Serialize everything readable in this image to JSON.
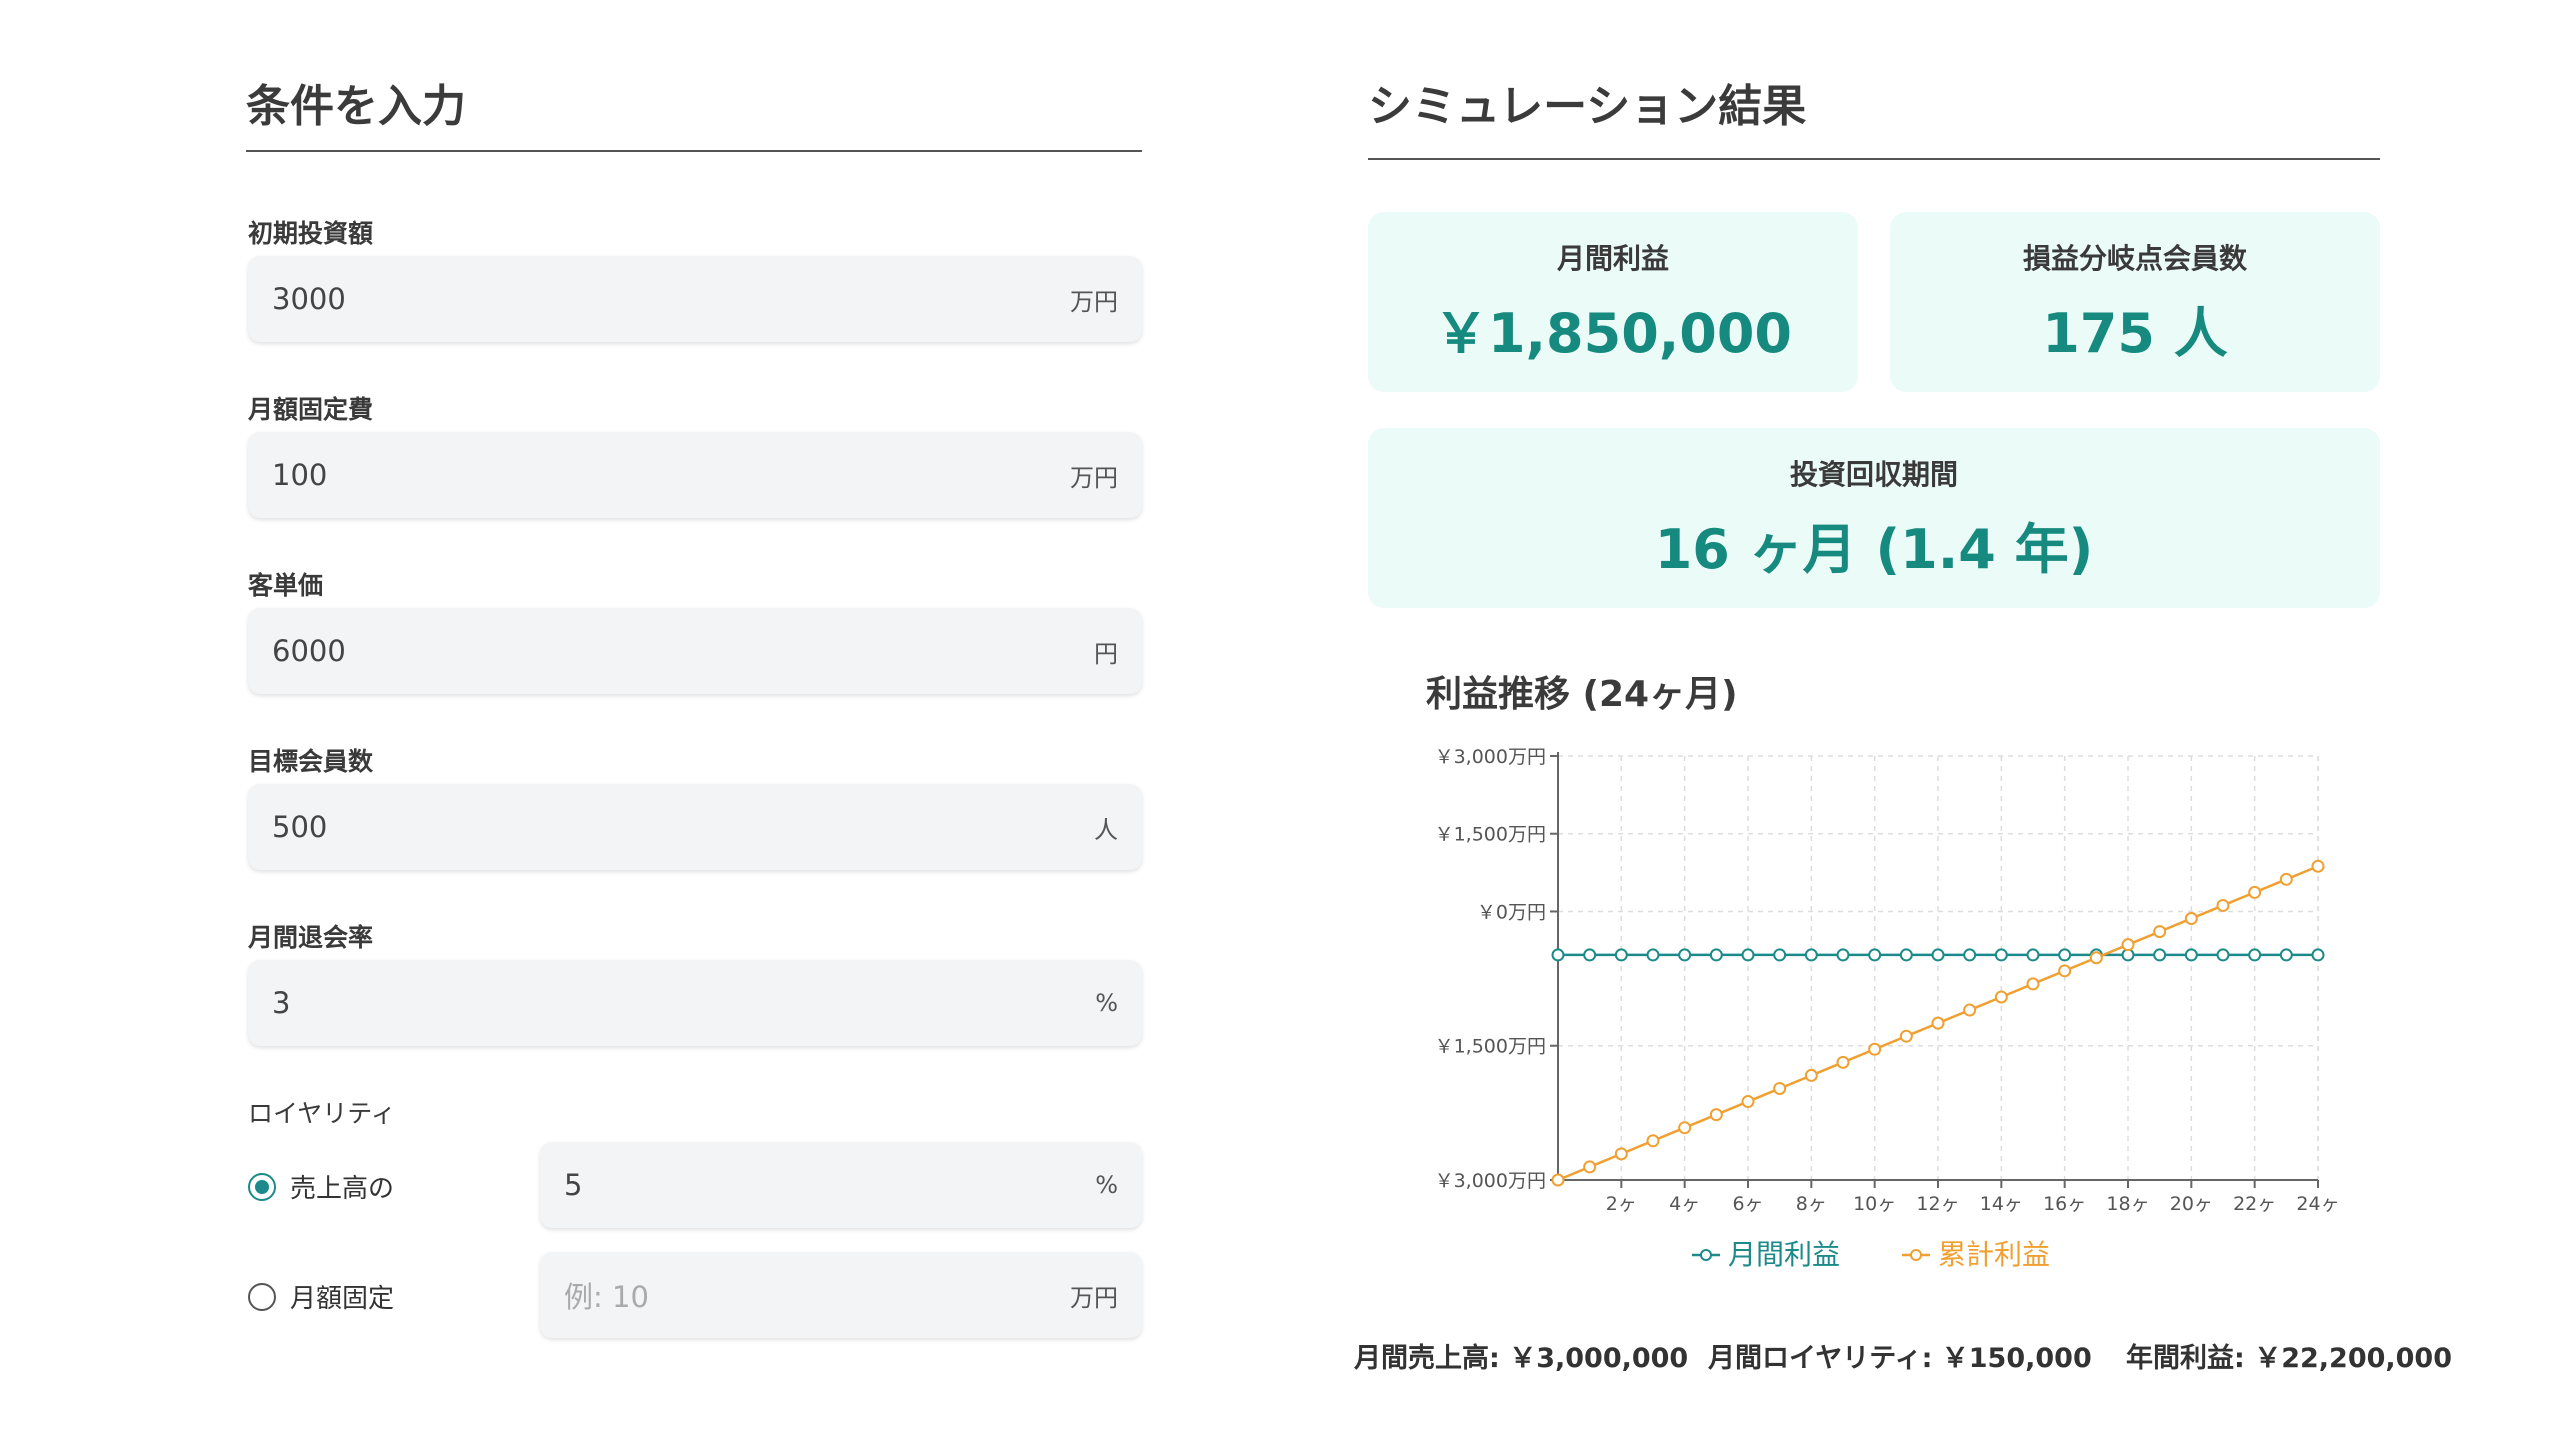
{
  "left": {
    "title": "条件を入力",
    "fields": [
      {
        "label": "初期投資額",
        "value": "3000",
        "unit": "万円"
      },
      {
        "label": "月額固定費",
        "value": "100",
        "unit": "万円"
      },
      {
        "label": "客単価",
        "value": "6000",
        "unit": "円"
      },
      {
        "label": "目標会員数",
        "value": "500",
        "unit": "人"
      },
      {
        "label": "月間退会率",
        "value": "3",
        "unit": "%"
      }
    ],
    "royalty": {
      "label": "ロイヤリティ",
      "option1": {
        "label": "売上高の",
        "value": "5",
        "unit": "%",
        "checked": true
      },
      "option2": {
        "label": "月額固定",
        "placeholder": "例: 10",
        "unit": "万円",
        "checked": false
      }
    }
  },
  "right": {
    "title": "シミュレーション結果",
    "cards": {
      "monthly_profit": {
        "label": "月間利益",
        "value": "￥1,850,000"
      },
      "breakeven": {
        "label": "損益分岐点会員数",
        "value": "175 人"
      },
      "payback": {
        "label": "投資回収期間",
        "value": "16 ヶ月 (1.4 年)"
      }
    },
    "chart_title": "利益推移 (24ヶ月)",
    "summary": {
      "sales": "月間売上高: ￥3,000,000",
      "royalty": "月間ロイヤリティ: ￥150,000",
      "annual": "年間利益: ￥22,200,000"
    }
  },
  "colors": {
    "teal": "#1c8a8a",
    "orange": "#f0a030",
    "card_bg": "#ebfbf8",
    "value_teal": "#168a7e"
  },
  "chart_data": {
    "type": "line",
    "title": "利益推移 (24ヶ月)",
    "x_tick_labels": [
      "2ヶ",
      "4ヶ",
      "6ヶ",
      "8ヶ",
      "10ヶ",
      "12ヶ",
      "14ヶ",
      "16ヶ",
      "18ヶ",
      "20ヶ",
      "22ヶ",
      "24ヶ"
    ],
    "x": [
      0,
      1,
      2,
      3,
      4,
      5,
      6,
      7,
      8,
      9,
      10,
      11,
      12,
      13,
      14,
      15,
      16,
      17,
      18,
      19,
      20,
      21,
      22,
      23,
      24
    ],
    "y_tick_labels": [
      "￥3,000万円",
      "￥1,500万円",
      "￥0万円",
      "￥1,500万円",
      "￥3,000万円"
    ],
    "ylim": [
      -3000,
      3000
    ],
    "y_unit": "万円",
    "grid": true,
    "legend_position": "bottom",
    "series": [
      {
        "name": "月間利益",
        "color": "#1c8a8a",
        "values": [
          185,
          185,
          185,
          185,
          185,
          185,
          185,
          185,
          185,
          185,
          185,
          185,
          185,
          185,
          185,
          185,
          185,
          185,
          185,
          185,
          185,
          185,
          185,
          185,
          185
        ]
      },
      {
        "name": "累計利益",
        "color": "#f0a030",
        "values": [
          -3000,
          -2815,
          -2630,
          -2445,
          -2260,
          -2075,
          -1890,
          -1705,
          -1520,
          -1335,
          -1150,
          -965,
          -780,
          -595,
          -410,
          -225,
          -40,
          145,
          330,
          515,
          700,
          885,
          1070,
          1255,
          1440
        ]
      }
    ]
  }
}
